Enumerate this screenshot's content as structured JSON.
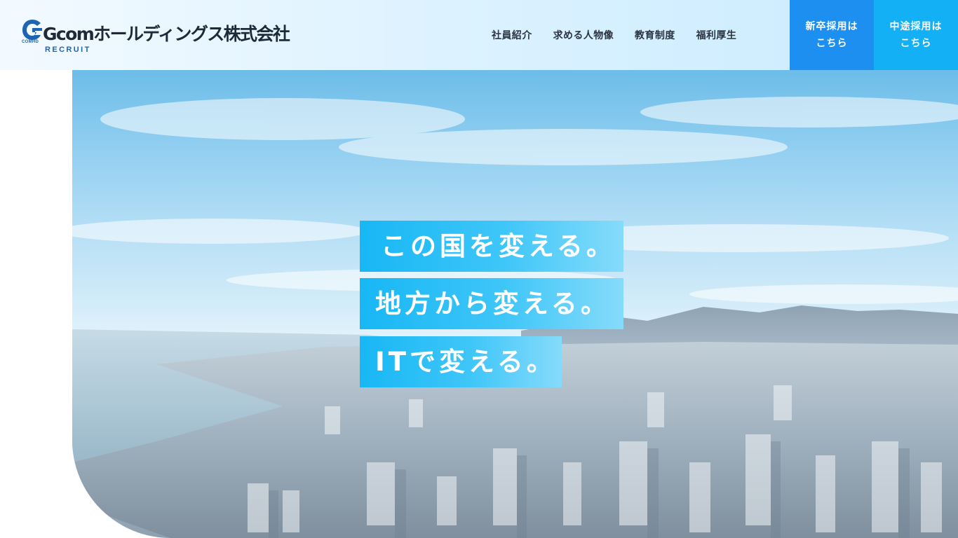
{
  "header": {
    "logo": {
      "mark_text": "COMHD",
      "company_name": "Gcomホールディングス株式会社",
      "sub_label": "RECRUIT",
      "icon": "gcom-logo-icon",
      "brand_color": "#1e64b4"
    },
    "nav": [
      {
        "label": "社員紹介"
      },
      {
        "label": "求める人物像"
      },
      {
        "label": "教育制度"
      },
      {
        "label": "福利厚生"
      }
    ],
    "cta_new_grad": {
      "line1": "新卒採用は",
      "line2": "こちら",
      "color": "#1c8ff0"
    },
    "cta_mid_career": {
      "line1": "中途採用は",
      "line2": "こちら",
      "color": "#14b0f6"
    }
  },
  "hero": {
    "image": "aerial-city-photo",
    "catchcopy": [
      "この国を変える。",
      "地方から変える。",
      "ITで変える。"
    ],
    "accent_color": "#17b7f5"
  }
}
